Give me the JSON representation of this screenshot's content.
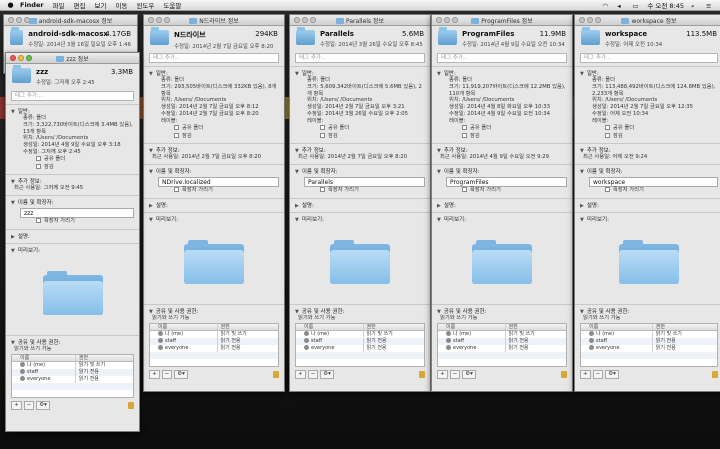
{
  "menubar": {
    "app": "Finder",
    "items": [
      "파일",
      "편집",
      "보기",
      "이동",
      "윈도우",
      "도움말"
    ],
    "clock": "수 오전 8:45"
  },
  "colors": {
    "folder": "#7fb7e4",
    "close": "#ee5a52",
    "minimize": "#f4bd44",
    "zoom": "#5fc44c"
  },
  "common": {
    "tags_placeholder": "태그 추가...",
    "general": "일반:",
    "more_info": "추가 정보:",
    "name_ext": "이름 및 확장자:",
    "comments": "설명:",
    "preview": "미리보기:",
    "sharing": "공유 및 사용 권한:",
    "sharing_note": "읽기와 쓰기 가능",
    "hide_ext": "확장자 가리기",
    "shared_folder": "공유 폴더",
    "locked": "잠김",
    "perm_name": "이름",
    "perm_priv": "권한",
    "kind": "종류: 폴더",
    "icons": [
      "folder-icon",
      "lock-icon",
      "gear-icon",
      "add-icon",
      "remove-icon"
    ]
  },
  "back_window": {
    "title": "android-sdk-macosx 정보",
    "name": "android-sdk-macosx",
    "size": "4.17GB",
    "modified": "수정일: 2014년 3월 16일 일요일 오후 1:46"
  },
  "windows": [
    {
      "id": "ndrive",
      "title": "N드라이브 정보",
      "name": "N드라이브",
      "size": "294KB",
      "modified": "수정일: 2014년 2월 7일 금요일 오후 8:20",
      "size_line": "크기: 293,505바이트(디스크에 332KB 있음), 8개 항목",
      "where": "위치: /Users/             /Documents",
      "created": "생성일: 2014년 2월 7일 금요일 오후 8:12",
      "mod2": "수정일: 2014년 2월 7일 금요일 오후 8:20",
      "label": "레이블:",
      "last_used": "최근 사용일: 2014년 2월 7일 금요일 오후 8:20",
      "filename": "NDrive.localized",
      "perms": [
        [
          "나 (me)",
          "읽기 및 쓰기"
        ],
        [
          "staff",
          "읽기 전용"
        ],
        [
          "everyone",
          "읽기 전용"
        ]
      ]
    },
    {
      "id": "parallels",
      "title": "Parallels 정보",
      "name": "Parallels",
      "size": "5.6MB",
      "modified": "수정일: 2014년 3월 26일 수요일 오후 8:45",
      "size_line": "크기: 5,609,342바이트(디스크에 5.6MB 있음), 2개 항목",
      "where": "위치: /Users/             /Documents",
      "created": "생성일: 2014년 2월 7일 금요일 오후 3:21",
      "mod2": "수정일: 2014년 3월 26일 수요일 오후 2:05",
      "label": "레이블:",
      "last_used": "최근 사용일: 2014년 2월 7일 금요일 오후 8:20",
      "filename": "Parallels",
      "perms": [
        [
          "나 (me)",
          "읽기 및 쓰기"
        ],
        [
          "staff",
          "읽기 전용"
        ],
        [
          "everyone",
          "읽기 전용"
        ]
      ]
    },
    {
      "id": "programfiles",
      "title": "ProgramFiles 정보",
      "name": "ProgramFiles",
      "size": "11.9MB",
      "modified": "수정일: 2014년 4월 9일 수요일 오전 10:34",
      "size_line": "크기: 11,919,207바이트(디스크에 12.2MB 있음), 110개 항목",
      "where": "위치: /Users/             /Documents",
      "created": "생성일: 2014년 4월 8일 화요일 오후 10:33",
      "mod2": "수정일: 2014년 4월 9일 수요일 오전 10:34",
      "label": "레이블:",
      "last_used": "최근 사용일: 2014년 4월 9일 수요일 오전 9:29",
      "filename": "ProgramFiles",
      "perms": [
        [
          "나 (me)",
          "읽기 및 쓰기"
        ],
        [
          "staff",
          "읽기 전용"
        ],
        [
          "everyone",
          "읽기 전용"
        ]
      ]
    },
    {
      "id": "workspace",
      "title": "workspace 정보",
      "name": "workspace",
      "size": "113.5MB",
      "modified": "수정일: 어제 오전 10:34",
      "size_line": "크기: 113,488,492바이트(디스크에 124.8MB 있음), 2,233개 항목",
      "where": "위치: /Users/             /Documents",
      "created": "생성일: 2014년 2월 7일 금요일 오후 12:35",
      "mod2": "수정일: 어제 오전 10:34",
      "label": "레이블:",
      "last_used": "최근 사용일: 어제 오전 9:24",
      "filename": "workspace",
      "perms": [
        [
          "나 (me)",
          "읽기 및 쓰기"
        ],
        [
          "staff",
          "읽기 전용"
        ],
        [
          "everyone",
          "읽기 전용"
        ]
      ]
    }
  ],
  "zzz": {
    "title": "zzz 정보",
    "name": "zzz",
    "size": "3.3MB",
    "modified": "수정일: 그저께 오후 2:45",
    "size_line": "크기: 3,322,730바이트(디스크에 3.4MB 있음), 13개 항목",
    "where": "위치: /Users/             /Documents",
    "created": "생성일: 2014년 4월 9일 수요일 오후 3:18",
    "mod2": "수정일: 그저께 오후 2:45",
    "last_used": "최근 사용일: 그저께 오전 9:45",
    "filename": "zzz",
    "perms": [
      [
        "나 (me)",
        "읽기 및 쓰기"
      ],
      [
        "staff",
        "읽기 전용"
      ],
      [
        "everyone",
        "읽기 전용"
      ]
    ]
  }
}
